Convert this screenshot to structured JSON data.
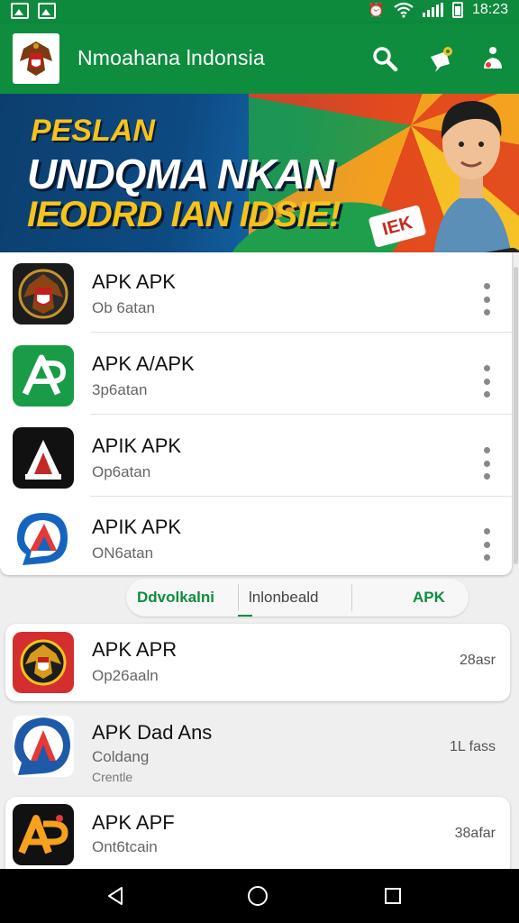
{
  "status_bar": {
    "time": "18:23"
  },
  "app_bar": {
    "title": "Nmoahana lndonsia",
    "icons": [
      "search-icon",
      "notification-icon",
      "account-icon"
    ]
  },
  "banner": {
    "line1": "PESLAN",
    "line2": "UNDQMA NKAN",
    "line3": "IEODRD IAN IDSIE!",
    "badge": "IEK"
  },
  "apps": [
    {
      "title": "APK APK",
      "subtitle": "Ob 6atan",
      "icon": "garuda-emblem-icon"
    },
    {
      "title": "APK A/APK",
      "subtitle": "3p6atan",
      "icon": "green-ap-logo-icon"
    },
    {
      "title": "APIK APK",
      "subtitle": "Op6atan",
      "icon": "black-a-logo-icon"
    },
    {
      "title": "APIK APK",
      "subtitle": "ON6atan",
      "icon": "blue-a-logo-icon"
    }
  ],
  "tabs": {
    "tab1": "Ddvolkalni",
    "tab2": "lnlonbeald",
    "tab3": "APK"
  },
  "list2": [
    {
      "title": "APK APR",
      "subtitle": "Op26aaln",
      "meta": "28asr",
      "icon": "red-garuda-icon"
    },
    {
      "title": "APK Dad Ans",
      "subtitle": "Coldang",
      "sub2": "Crentle",
      "meta": "1L fass",
      "icon": "blue-emblem-icon"
    },
    {
      "title": "APK APF",
      "subtitle": "Ont6tcain",
      "meta": "38afar",
      "icon": "ap-orange-logo-icon"
    }
  ],
  "nav": [
    "back-icon",
    "home-icon",
    "recents-icon"
  ],
  "colors": {
    "primary": "#0f8d3f",
    "accent": "#f6c21c"
  }
}
